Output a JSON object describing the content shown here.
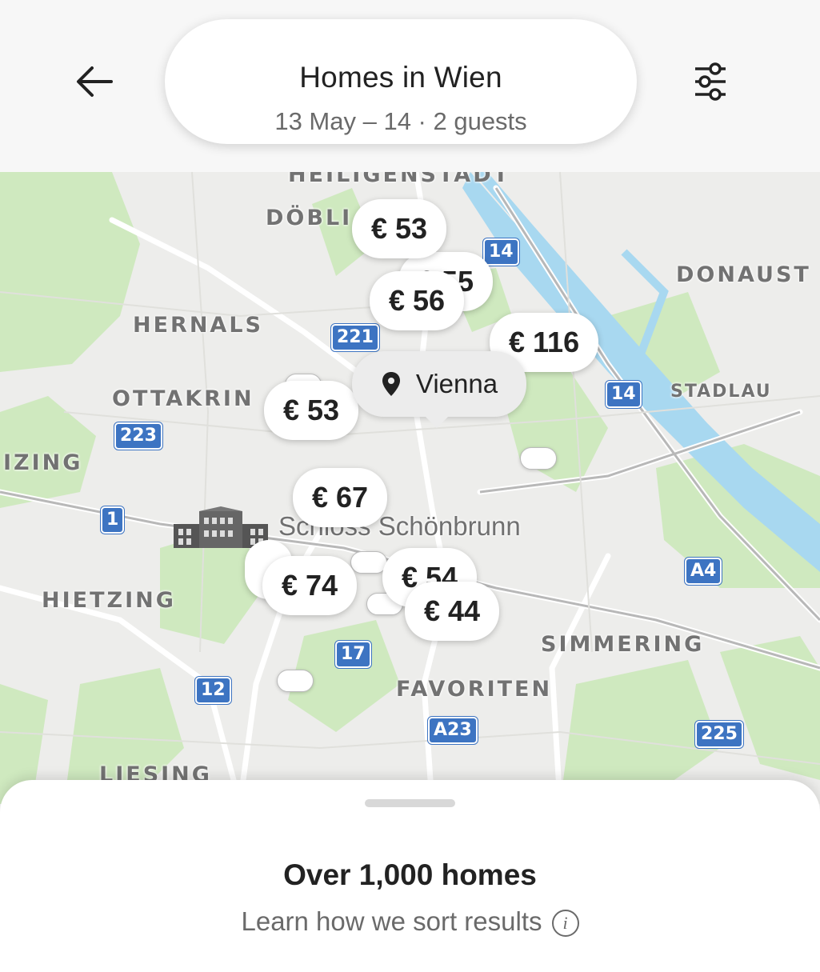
{
  "header": {
    "back_icon": "arrow-left-icon",
    "title": "Homes in Wien",
    "subtitle": "13 May – 14 · 2 guests",
    "filter_icon": "sliders-icon"
  },
  "map": {
    "districts": [
      {
        "id": "heiligenstadt",
        "label": "HEILIGENSTADT"
      },
      {
        "id": "doebling",
        "label": "DÖBLI"
      },
      {
        "id": "donaustadt",
        "label": "DONAUST"
      },
      {
        "id": "hernals",
        "label": "HERNALS"
      },
      {
        "id": "ottakring",
        "label": "OTTAKRIN"
      },
      {
        "id": "stadlau",
        "label": "STADLAU"
      },
      {
        "id": "penzing",
        "label": "IZING"
      },
      {
        "id": "hietzing",
        "label": "HIETZING"
      },
      {
        "id": "simmering",
        "label": "SIMMERING"
      },
      {
        "id": "favoriten",
        "label": "FAVORITEN"
      },
      {
        "id": "liesing",
        "label": "LIESING"
      }
    ],
    "routes": [
      "14",
      "221",
      "14",
      "223",
      "1",
      "A4",
      "17",
      "12",
      "A23",
      "225"
    ],
    "poi": {
      "label": "Schloss Schönbrunn",
      "icon": "palace-icon"
    },
    "location_pin": {
      "label": "Vienna",
      "icon": "map-pin-icon"
    },
    "prices": [
      "€ 53",
      "€ 55",
      "€ 56",
      "€ 116",
      "€ 53",
      "€ 67",
      "€ 74",
      "€ 54",
      "€ 44"
    ],
    "colors": {
      "land": "#ededeb",
      "park": "#cfe9bf",
      "water": "#a8d8f0",
      "route_badge": "#3d74c2"
    }
  },
  "sheet": {
    "title": "Over 1,000 homes",
    "link": "Learn how we sort results",
    "info_icon": "i"
  }
}
